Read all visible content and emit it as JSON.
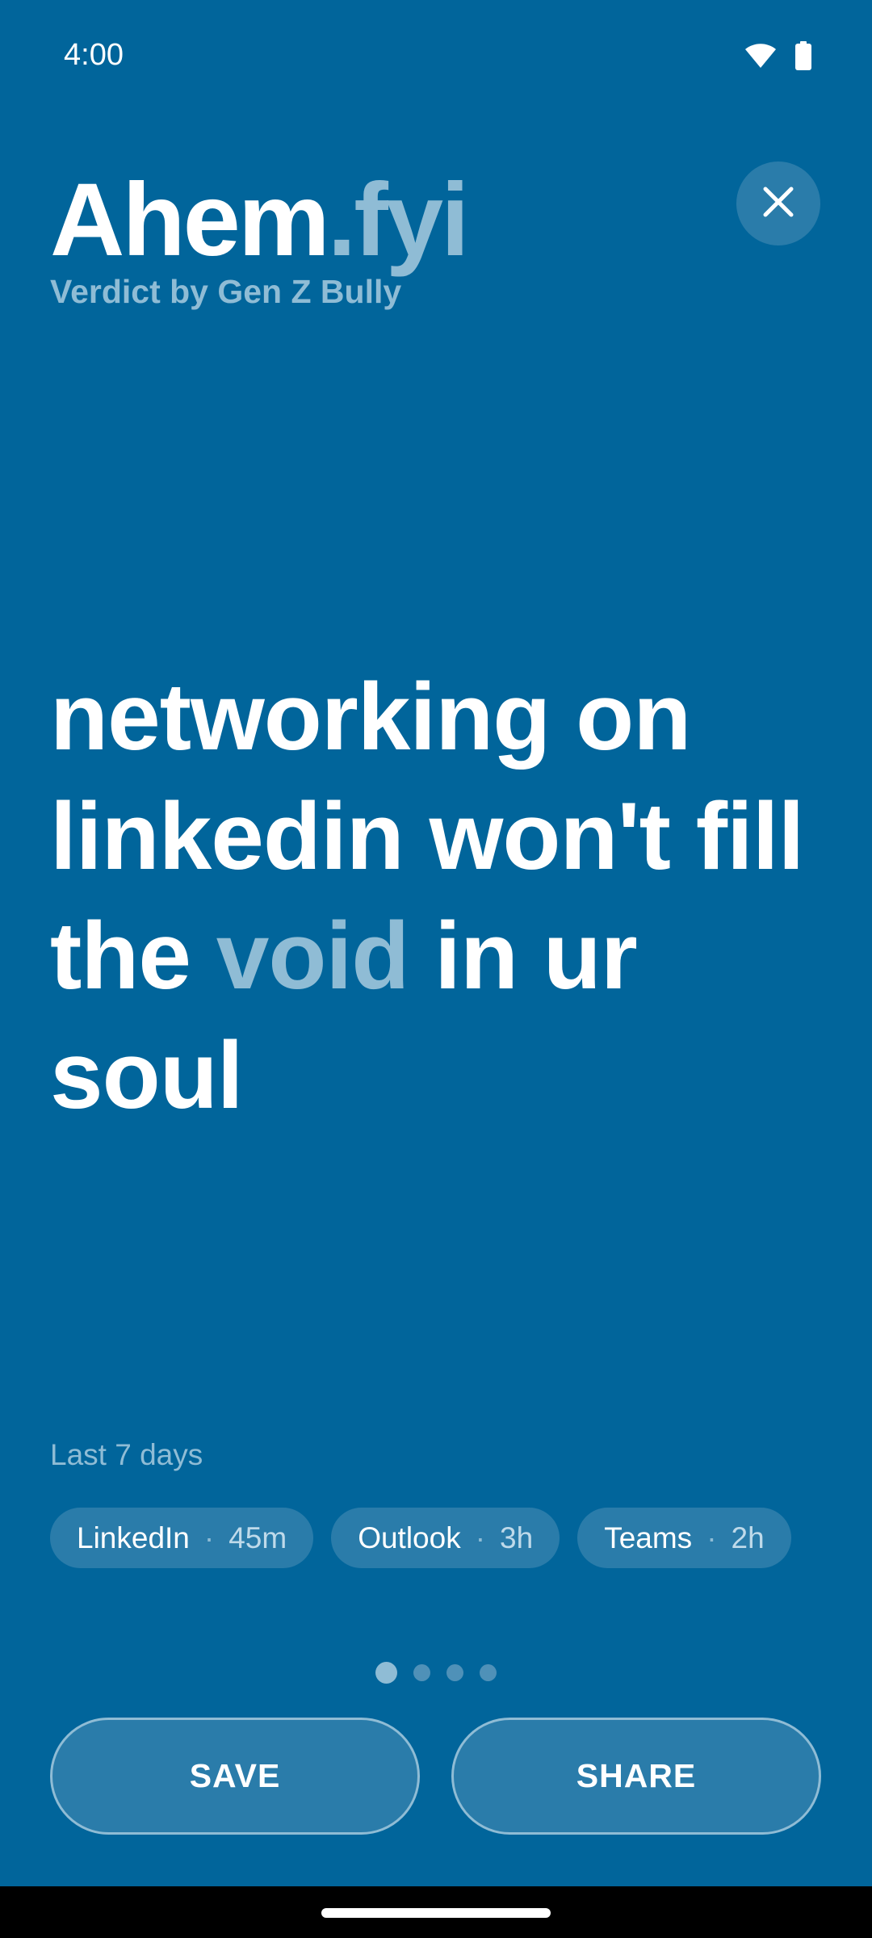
{
  "status_bar": {
    "time": "4:00",
    "icons": [
      "wifi-icon",
      "battery-icon"
    ]
  },
  "header": {
    "brand_main": "Ahem",
    "brand_suffix": ".fyi",
    "subtitle": "Verdict by Gen Z Bully",
    "close_icon": "close-icon"
  },
  "verdict": {
    "before": "networking on linkedin won't fill the ",
    "highlight": "void",
    "after": " in ur soul"
  },
  "usage": {
    "period_label": "Last 7 days",
    "separator": "·",
    "chips": [
      {
        "app": "LinkedIn",
        "time": "45m"
      },
      {
        "app": "Outlook",
        "time": "3h"
      },
      {
        "app": "Teams",
        "time": "2h"
      }
    ]
  },
  "pager": {
    "total": 4,
    "current": 1
  },
  "actions": {
    "save_label": "SAVE",
    "share_label": "SHARE"
  },
  "colors": {
    "background": "#01659B",
    "accent": "#8FBCD5",
    "chip_bg": "#2A7CAA",
    "text": "#FFFFFF"
  }
}
